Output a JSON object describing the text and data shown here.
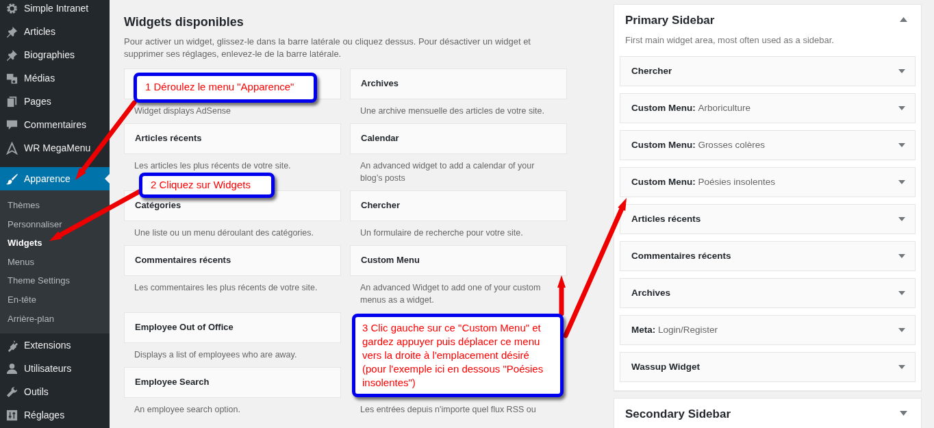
{
  "admin_menu": {
    "items": [
      {
        "label": "Simple Intranet",
        "selected": false
      },
      {
        "label": "Articles",
        "selected": false
      },
      {
        "label": "Biographies",
        "selected": false
      },
      {
        "label": "Médias",
        "selected": false
      },
      {
        "label": "Pages",
        "selected": false
      },
      {
        "label": "Commentaires",
        "selected": false
      },
      {
        "label": "WR MegaMenu",
        "selected": false
      },
      {
        "label": "Apparence",
        "selected": true,
        "children": [
          {
            "label": "Thèmes",
            "selected": false
          },
          {
            "label": "Personnaliser",
            "selected": false
          },
          {
            "label": "Widgets",
            "selected": true
          },
          {
            "label": "Menus",
            "selected": false
          },
          {
            "label": "Theme Settings",
            "selected": false
          },
          {
            "label": "En-tête",
            "selected": false
          },
          {
            "label": "Arrière-plan",
            "selected": false
          }
        ]
      },
      {
        "label": "Extensions",
        "selected": false
      },
      {
        "label": "Utilisateurs",
        "selected": false
      },
      {
        "label": "Outils",
        "selected": false
      },
      {
        "label": "Réglages",
        "selected": false
      }
    ]
  },
  "available_widgets": {
    "title": "Widgets disponibles",
    "description": "Pour activer un widget, glissez-le dans la barre latérale ou cliquez dessus. Pour désactiver un widget et supprimer ses réglages, enlevez-le de la barre latérale.",
    "rows": [
      {
        "left": {
          "description": "Widget displays AdSense"
        },
        "right": {
          "title": "Archives",
          "description": "Une archive mensuelle des articles de votre site."
        }
      },
      {
        "left": {
          "title": "Articles récents",
          "description": "Les articles les plus récents de votre site."
        },
        "right": {
          "title": "Calendar",
          "description": "An advanced widget to add a calendar of your blog’s posts"
        }
      },
      {
        "left": {
          "title": "Catégories",
          "description": "Une liste ou un menu déroulant des catégories."
        },
        "right": {
          "title": "Chercher",
          "description": "Un formulaire de recherche pour votre site."
        }
      },
      {
        "left": {
          "title": "Commentaires récents",
          "description": "Les commentaires les plus récents de votre site."
        },
        "right": {
          "title": "Custom Menu",
          "description": "An advanced Widget to add one of your custom menus as a widget."
        }
      },
      {
        "left": {
          "title": "Employee Out of Office",
          "description": "Displays a list of employees who are away."
        }
      },
      {
        "left": {
          "title": "Employee Search",
          "description": "An employee search option."
        },
        "right": {
          "kind": "description_only",
          "description": "Les entrées depuis n'importe quel flux RSS ou"
        }
      }
    ]
  },
  "sidebars": [
    {
      "title": "Primary Sidebar",
      "description": "First main widget area, most often used as a sidebar.",
      "expanded": true,
      "widgets": [
        {
          "title": "Chercher"
        },
        {
          "title": "Custom Menu:",
          "subtitle": "Arboriculture"
        },
        {
          "title": "Custom Menu:",
          "subtitle": "Grosses colères"
        },
        {
          "title": "Custom Menu:",
          "subtitle": "Poésies insolentes"
        },
        {
          "title": "Articles récents"
        },
        {
          "title": "Commentaires récents"
        },
        {
          "title": "Archives"
        },
        {
          "title": "Meta:",
          "subtitle": "Login/Register"
        },
        {
          "title": "Wassup Widget"
        }
      ]
    },
    {
      "title": "Secondary Sidebar",
      "expanded": false
    }
  ],
  "annotations": [
    {
      "text": "1 Déroulez le menu \"Apparence\""
    },
    {
      "text": "2 Cliquez sur Widgets"
    },
    {
      "text": "3 Clic gauche sur ce \"Custom Menu\" et gardez appuyer puis déplacer ce menu vers la droite à l'emplacement désiré (pour l'exemple ici en dessous \"Poésies insolentes\")"
    }
  ]
}
